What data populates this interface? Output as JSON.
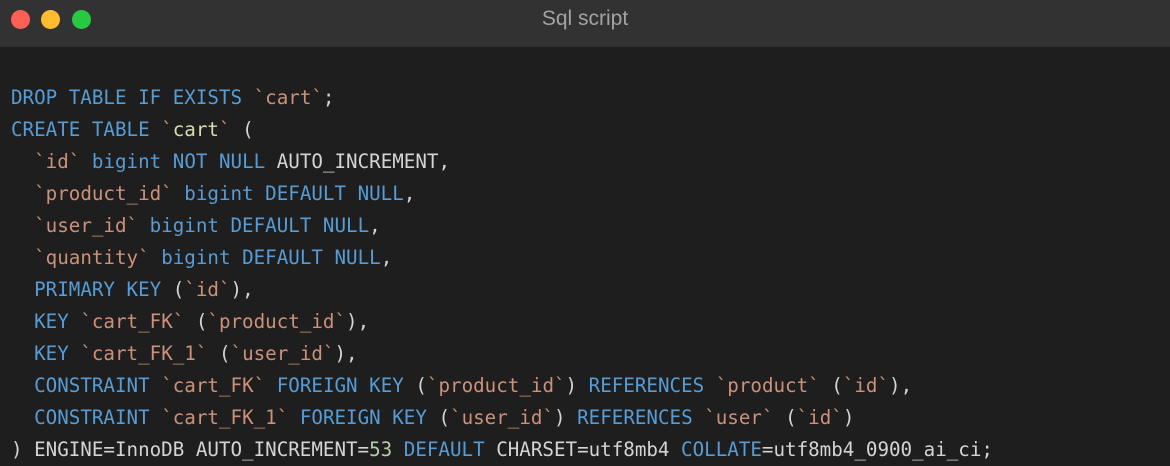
{
  "window": {
    "title": "Sql script"
  },
  "colors": {
    "keyword": "#569cd6",
    "identifier": "#ce9178",
    "plain": "#d4d4d4",
    "number": "#b5cea8",
    "background": "#1e1e1e",
    "titlebar": "#323233"
  },
  "code": {
    "language": "sql",
    "lines": [
      [
        {
          "t": "DROP TABLE IF EXISTS",
          "k": "keyword"
        },
        {
          "t": " ",
          "k": "plain"
        },
        {
          "t": "`cart`",
          "k": "ident"
        },
        {
          "t": ";",
          "k": "plain"
        }
      ],
      [
        {
          "t": "CREATE TABLE",
          "k": "keyword"
        },
        {
          "t": " ",
          "k": "plain"
        },
        {
          "t": "`",
          "k": "ident"
        },
        {
          "t": "cart",
          "k": "name"
        },
        {
          "t": "`",
          "k": "ident"
        },
        {
          "t": " (",
          "k": "plain"
        }
      ],
      [
        {
          "t": "  ",
          "k": "plain"
        },
        {
          "t": "`id`",
          "k": "ident"
        },
        {
          "t": " ",
          "k": "plain"
        },
        {
          "t": "bigint",
          "k": "keyword"
        },
        {
          "t": " ",
          "k": "plain"
        },
        {
          "t": "NOT NULL",
          "k": "keyword"
        },
        {
          "t": " AUTO_INCREMENT,",
          "k": "plain"
        }
      ],
      [
        {
          "t": "  ",
          "k": "plain"
        },
        {
          "t": "`product_id`",
          "k": "ident"
        },
        {
          "t": " ",
          "k": "plain"
        },
        {
          "t": "bigint DEFAULT NULL",
          "k": "keyword"
        },
        {
          "t": ",",
          "k": "plain"
        }
      ],
      [
        {
          "t": "  ",
          "k": "plain"
        },
        {
          "t": "`user_id`",
          "k": "ident"
        },
        {
          "t": " ",
          "k": "plain"
        },
        {
          "t": "bigint DEFAULT NULL",
          "k": "keyword"
        },
        {
          "t": ",",
          "k": "plain"
        }
      ],
      [
        {
          "t": "  ",
          "k": "plain"
        },
        {
          "t": "`quantity`",
          "k": "ident"
        },
        {
          "t": " ",
          "k": "plain"
        },
        {
          "t": "bigint DEFAULT NULL",
          "k": "keyword"
        },
        {
          "t": ",",
          "k": "plain"
        }
      ],
      [
        {
          "t": "  ",
          "k": "plain"
        },
        {
          "t": "PRIMARY KEY",
          "k": "keyword"
        },
        {
          "t": " (",
          "k": "plain"
        },
        {
          "t": "`id`",
          "k": "ident"
        },
        {
          "t": "),",
          "k": "plain"
        }
      ],
      [
        {
          "t": "  ",
          "k": "plain"
        },
        {
          "t": "KEY",
          "k": "keyword"
        },
        {
          "t": " ",
          "k": "plain"
        },
        {
          "t": "`cart_FK`",
          "k": "ident"
        },
        {
          "t": " (",
          "k": "plain"
        },
        {
          "t": "`product_id`",
          "k": "ident"
        },
        {
          "t": "),",
          "k": "plain"
        }
      ],
      [
        {
          "t": "  ",
          "k": "plain"
        },
        {
          "t": "KEY",
          "k": "keyword"
        },
        {
          "t": " ",
          "k": "plain"
        },
        {
          "t": "`cart_FK_1`",
          "k": "ident"
        },
        {
          "t": " (",
          "k": "plain"
        },
        {
          "t": "`user_id`",
          "k": "ident"
        },
        {
          "t": "),",
          "k": "plain"
        }
      ],
      [
        {
          "t": "  ",
          "k": "plain"
        },
        {
          "t": "CONSTRAINT",
          "k": "keyword"
        },
        {
          "t": " ",
          "k": "plain"
        },
        {
          "t": "`cart_FK`",
          "k": "ident"
        },
        {
          "t": " ",
          "k": "plain"
        },
        {
          "t": "FOREIGN KEY",
          "k": "keyword"
        },
        {
          "t": " (",
          "k": "plain"
        },
        {
          "t": "`product_id`",
          "k": "ident"
        },
        {
          "t": ") ",
          "k": "plain"
        },
        {
          "t": "REFERENCES",
          "k": "keyword"
        },
        {
          "t": " ",
          "k": "plain"
        },
        {
          "t": "`product`",
          "k": "ident"
        },
        {
          "t": " (",
          "k": "plain"
        },
        {
          "t": "`id`",
          "k": "ident"
        },
        {
          "t": "),",
          "k": "plain"
        }
      ],
      [
        {
          "t": "  ",
          "k": "plain"
        },
        {
          "t": "CONSTRAINT",
          "k": "keyword"
        },
        {
          "t": " ",
          "k": "plain"
        },
        {
          "t": "`cart_FK_1`",
          "k": "ident"
        },
        {
          "t": " ",
          "k": "plain"
        },
        {
          "t": "FOREIGN KEY",
          "k": "keyword"
        },
        {
          "t": " (",
          "k": "plain"
        },
        {
          "t": "`user_id`",
          "k": "ident"
        },
        {
          "t": ") ",
          "k": "plain"
        },
        {
          "t": "REFERENCES",
          "k": "keyword"
        },
        {
          "t": " ",
          "k": "plain"
        },
        {
          "t": "`user`",
          "k": "ident"
        },
        {
          "t": " (",
          "k": "plain"
        },
        {
          "t": "`id`",
          "k": "ident"
        },
        {
          "t": ")",
          "k": "plain"
        }
      ],
      [
        {
          "t": ") ENGINE=InnoDB AUTO_INCREMENT=",
          "k": "plain"
        },
        {
          "t": "53",
          "k": "number"
        },
        {
          "t": " ",
          "k": "plain"
        },
        {
          "t": "DEFAULT",
          "k": "keyword"
        },
        {
          "t": " CHARSET=utf8mb4 ",
          "k": "plain"
        },
        {
          "t": "COLLATE",
          "k": "keyword"
        },
        {
          "t": "=utf8mb4_0900_ai_ci;",
          "k": "plain"
        }
      ]
    ]
  }
}
